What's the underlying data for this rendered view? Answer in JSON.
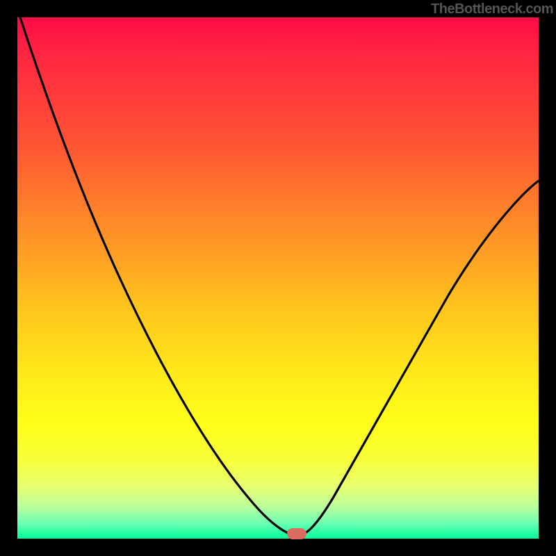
{
  "attribution": "TheBottleneck.com",
  "chart_data": {
    "type": "line",
    "title": "",
    "xlabel": "",
    "ylabel": "",
    "xlim": [
      0,
      100
    ],
    "ylim": [
      0,
      100
    ],
    "series": [
      {
        "name": "bottleneck-curve",
        "x": [
          0,
          10,
          20,
          30,
          40,
          45,
          50,
          52,
          54,
          56,
          60,
          70,
          80,
          90,
          100
        ],
        "y": [
          100,
          87,
          73,
          56,
          33,
          18,
          5,
          1,
          0,
          1,
          7,
          27,
          45,
          58,
          68
        ]
      }
    ],
    "marker": {
      "x": 53,
      "y": 0
    },
    "background": "rainbow-gradient-red-to-green"
  },
  "colors": {
    "curve": "#000000",
    "marker": "#d96b60",
    "frame": "#000000"
  }
}
